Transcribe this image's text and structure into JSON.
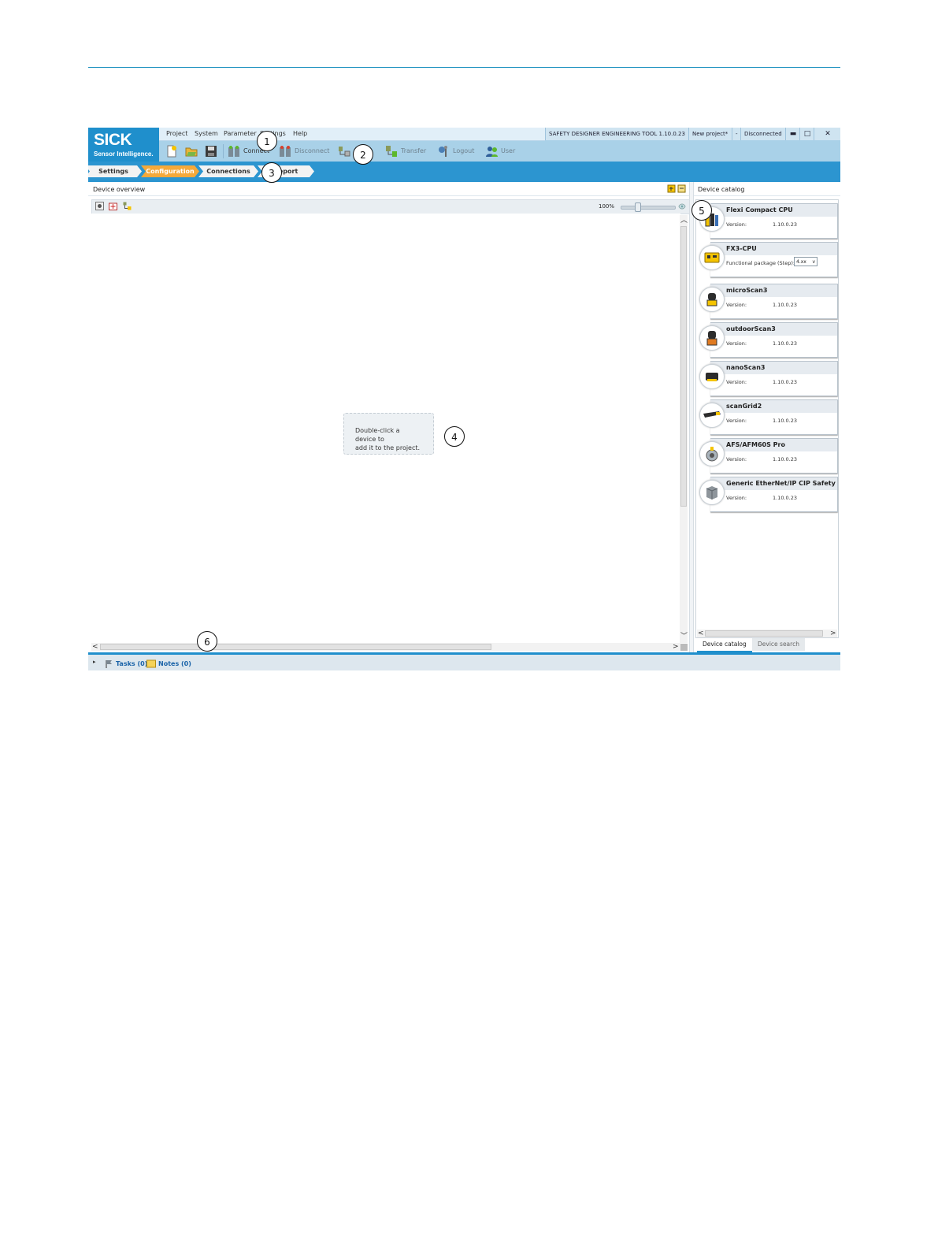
{
  "logo": {
    "name": "SICK",
    "tagline": "Sensor Intelligence."
  },
  "menu": [
    "Project",
    "System",
    "Parameter",
    "Settings",
    "Help"
  ],
  "title_bar": {
    "app_title": "SAFETY DESIGNER ENGINEERING TOOL 1.10.0.23",
    "project": "New project*",
    "dash": "-",
    "connection_status": "Disconnected",
    "minimize": "▬",
    "maximize": "□",
    "close": "✕"
  },
  "toolbar": {
    "connect": "Connect",
    "disconnect": "Disconnect",
    "transfer": "Transfer",
    "logout": "Logout",
    "user": "User"
  },
  "nav_tabs": [
    {
      "label": "Settings",
      "active": false
    },
    {
      "label": "Configuration",
      "active": true
    },
    {
      "label": "Connections",
      "active": false
    },
    {
      "label": "Report",
      "active": false
    }
  ],
  "device_overview": {
    "title": "Device overview",
    "zoom": "100%",
    "hint_line1": "Double-click a device to",
    "hint_line2": "add it to the project."
  },
  "device_catalog": {
    "title": "Device catalog",
    "devices": [
      {
        "name": "Flexi Compact CPU",
        "label": "Version:",
        "value": "1.10.0.23"
      },
      {
        "name": "FX3-CPU",
        "label": "Functional package (Step):",
        "value": "4.xx"
      },
      {
        "name": "microScan3",
        "label": "Version:",
        "value": "1.10.0.23"
      },
      {
        "name": "outdoorScan3",
        "label": "Version:",
        "value": "1.10.0.23"
      },
      {
        "name": "nanoScan3",
        "label": "Version:",
        "value": "1.10.0.23"
      },
      {
        "name": "scanGrid2",
        "label": "Version:",
        "value": "1.10.0.23"
      },
      {
        "name": "AFS/AFM60S Pro",
        "label": "Version:",
        "value": "1.10.0.23"
      },
      {
        "name": "Generic EtherNet/IP CIP Safety",
        "label": "Version:",
        "value": "1.10.0.23"
      }
    ],
    "tabs": [
      "Device catalog",
      "Device search"
    ]
  },
  "status_bar": {
    "tasks": "Tasks (0)",
    "notes": "Notes (0)"
  },
  "callouts": [
    "1",
    "2",
    "3",
    "4",
    "5",
    "6"
  ],
  "colors": {
    "brand": "#1f8fcc",
    "active_tab": "#f5a93a",
    "header": "#a9d1e8"
  }
}
